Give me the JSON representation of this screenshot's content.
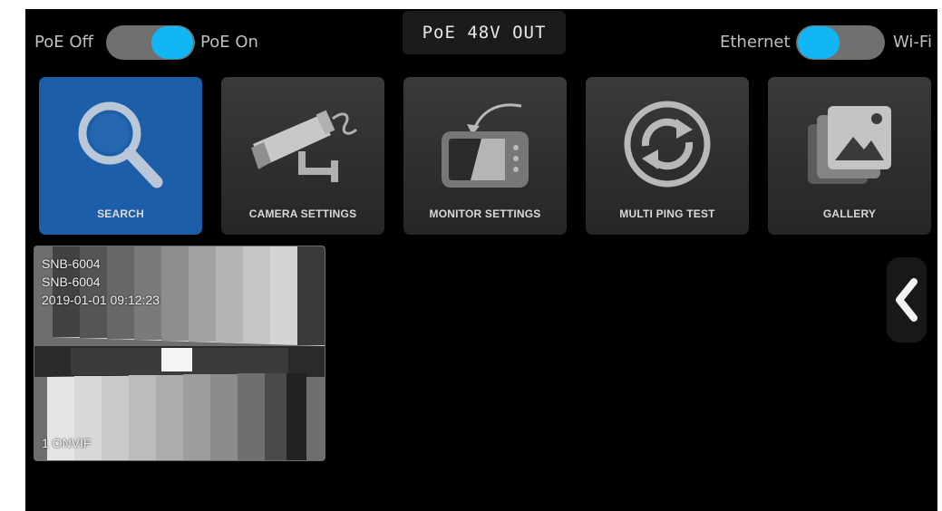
{
  "poe_toggle": {
    "off_label": "PoE Off",
    "on_label": "PoE On",
    "state": "on"
  },
  "poe_status": "PoE  48V  OUT",
  "network_toggle": {
    "left_label": "Ethernet",
    "right_label": "Wi-Fi",
    "selected": "Ethernet"
  },
  "tiles": [
    {
      "label": "SEARCH",
      "icon": "search-icon",
      "active": true
    },
    {
      "label": "CAMERA SETTINGS",
      "icon": "cctv-camera-icon",
      "active": false
    },
    {
      "label": "MONITOR SETTINGS",
      "icon": "monitor-device-icon",
      "active": false
    },
    {
      "label": "MULTI PING TEST",
      "icon": "refresh-icon",
      "active": false
    },
    {
      "label": "GALLERY",
      "icon": "gallery-icon",
      "active": false
    }
  ],
  "camera": {
    "model": "SNB-6004",
    "name": "SNB-6004",
    "timestamp": "2019-01-01 09:12:23",
    "channel_label": "1 ONVIF"
  },
  "colors": {
    "accent": "#13b6f5",
    "active_tile": "#1d5ea8",
    "toggle_track": "#707070"
  },
  "side_nav_icon": "chevron-left-icon"
}
